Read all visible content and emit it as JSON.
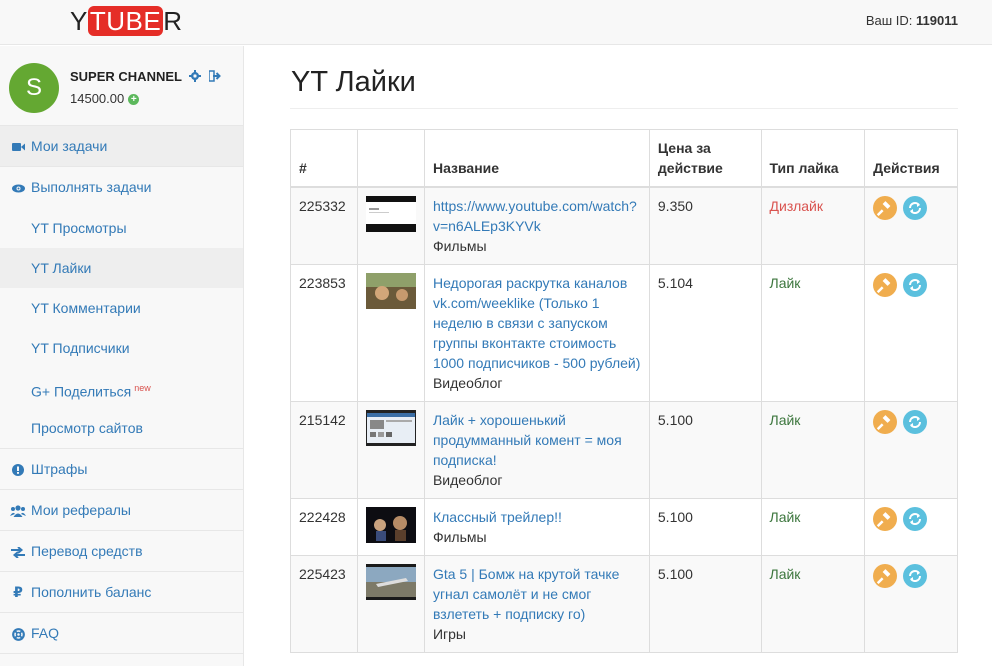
{
  "header": {
    "logo_left": "Y",
    "logo_tube": "TUBE",
    "logo_right": "R",
    "user_id_label": "Ваш ID:",
    "user_id_value": "119011"
  },
  "profile": {
    "avatar_letter": "S",
    "name": "SUPER CHANNEL",
    "balance": "14500.00"
  },
  "sidebar": {
    "my_tasks": "Мои задачи",
    "do_tasks": "Выполнять задачи",
    "sub": {
      "views": "YT Просмотры",
      "likes": "YT Лайки",
      "comments": "YT Комментарии",
      "subscribers": "YT Подписчики",
      "gplus": "G+ Поделиться",
      "gplus_badge": "new",
      "sites": "Просмотр сайтов"
    },
    "fines": "Штрафы",
    "referrals": "Мои рефералы",
    "transfer": "Перевод средств",
    "topup": "Пополнить баланс",
    "faq": "FAQ"
  },
  "page": {
    "title": "YT Лайки"
  },
  "table": {
    "headers": [
      "#",
      "",
      "Название",
      "Цена за действие",
      "Тип лайка",
      "Действия"
    ],
    "rows": [
      {
        "id": "225332",
        "title": "https://www.youtube.com/watch?v=n6ALEp3KYVk",
        "category": "Фильмы",
        "price": "9.350",
        "type": "Дизлайк",
        "type_kind": "dislike"
      },
      {
        "id": "223853",
        "title": "Недорогая раскрутка каналов vk.com/weeklike (Только 1 неделю в связи с запуском группы вконтакте стоимость 1000 подписчиков - 500 рублей)",
        "category": "Видеоблог",
        "price": "5.104",
        "type": "Лайк",
        "type_kind": "like"
      },
      {
        "id": "215142",
        "title": "Лайк + хорошенький продумманный комент = моя подписка!",
        "category": "Видеоблог",
        "price": "5.100",
        "type": "Лайк",
        "type_kind": "like"
      },
      {
        "id": "222428",
        "title": "Классный трейлер!!",
        "category": "Фильмы",
        "price": "5.100",
        "type": "Лайк",
        "type_kind": "like"
      },
      {
        "id": "225423",
        "title": "Gta 5 | Бомж на крутой тачке угнал самолёт и не смог взлететь + подписку го)",
        "category": "Игры",
        "price": "5.100",
        "type": "Лайк",
        "type_kind": "like"
      }
    ]
  },
  "colors": {
    "accent": "#337ab7",
    "brand": "#e52d27",
    "like": "#3c763d",
    "dislike": "#d9534f"
  }
}
